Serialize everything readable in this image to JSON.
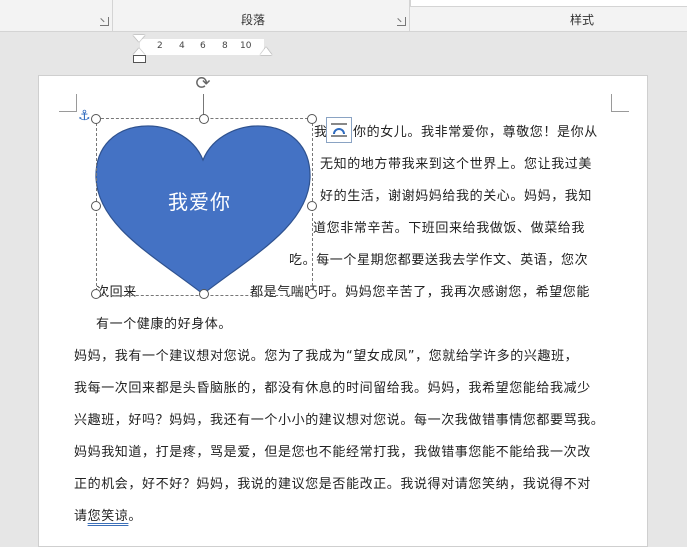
{
  "ribbon": {
    "paragraph_group": "段落",
    "styles_group": "样式"
  },
  "ruler": {
    "ticks": [
      "2",
      "4",
      "6",
      "8",
      "10"
    ]
  },
  "shape": {
    "type": "heart",
    "fill_color": "#4472C4",
    "text": "我爱你",
    "text_color": "#FFFFFF"
  },
  "document": {
    "lines_wrapped": [
      "我",
      "你的女儿。我非常爱你，尊敬您！是你从",
      "无知的地方带我来到这个世界上。您让我过美",
      "好的生活，谢谢妈妈给我的关心。妈妈，我知",
      "道您非常辛苦。下班回来给我做饭、做菜给我",
      "吃。每一个星期您都要送我去学作文、英语，您次",
      "次回来",
      "都是气喘吁吁。妈妈您辛苦了，我再次感谢您，希望您能",
      "有一个健康的好身体。"
    ],
    "paragraph2": [
      "妈妈，我有一个建议想对您说。您为了我成为“望女成凤”，您就给学许多的兴趣班，",
      "我每一次回来都是头昏脑胀的，都没有休息的时间留给我。妈妈，我希望您能给我减少",
      "兴趣班，好吗？妈妈，我还有一个小小的建议想对您说。每一次我做错事情您都要骂我。",
      "妈妈我知道，打是疼，骂是爱，但是您也不能经常打我，我做错事您能不能给我一次改",
      "正的机会，好不好？妈妈，我说的建议您是否能改正。我说得对请您笑纳，我说得不对"
    ],
    "last_line_prefix": "请",
    "last_line_word": "您笑谅",
    "last_line_suffix": "。"
  },
  "icons": {
    "rotate": "rotate-handle-icon",
    "anchor": "anchor-icon",
    "layout_options": "layout-options-icon"
  }
}
